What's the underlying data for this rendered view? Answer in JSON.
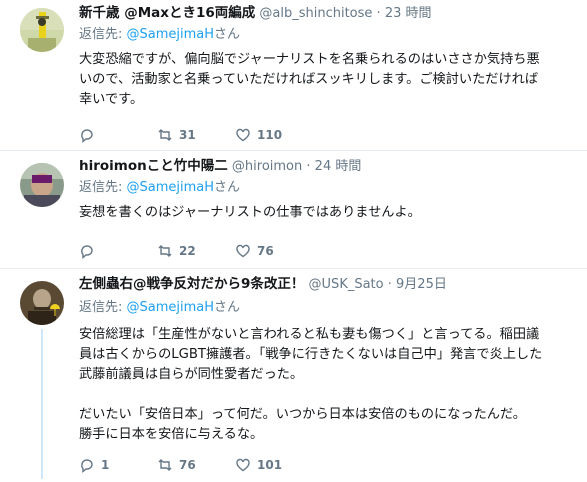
{
  "tweets": [
    {
      "name": "新千歳 @Maxとき16両編成",
      "handle": "@alb_shinchitose",
      "dot": "·",
      "time": "23 時間",
      "reply_prefix": "返信先: ",
      "reply_to": "@SamejimaH",
      "reply_suffix": "さん",
      "lines": [
        "大変恐縮ですが、偏向脳でジャーナリストを名乗られるのはいささか気持ち悪",
        "いので、活動家と名乗っていただければスッキリします。ご検討いただければ",
        "幸いです。"
      ],
      "reply_count": "",
      "retweet_count": "31",
      "like_count": "110"
    },
    {
      "name": "hiroimonこと竹中陽二",
      "handle": "@hiroimon",
      "dot": "·",
      "time": "24 時間",
      "reply_prefix": "返信先: ",
      "reply_to": "@SamejimaH",
      "reply_suffix": "さん",
      "lines": [
        "妄想を書くのはジャーナリストの仕事ではありませんよ。"
      ],
      "reply_count": "",
      "retweet_count": "22",
      "like_count": "76"
    },
    {
      "name": "左側蟲右@戦争反対だから9条改正！",
      "handle": "@USK_Sato",
      "dot": "·",
      "time": "9月25日",
      "reply_prefix": "返信先: ",
      "reply_to": "@SamejimaH",
      "reply_suffix": "さん",
      "lines": [
        "安倍総理は「生産性がないと言われると私も妻も傷つく」と言ってる。稲田議",
        "員は古くからのLGBT擁護者。「戦争に行きたくないは自己中」発言で炎上した",
        "武藤前議員は自らが同性愛者だった。",
        "",
        "だいたい「安倍日本」って何だ。いつから日本は安倍のものになったんだ。",
        "勝手に日本を安倍に与えるな。"
      ],
      "reply_count": "1",
      "retweet_count": "76",
      "like_count": "101"
    }
  ],
  "colors": {
    "text": "#14171a",
    "muted": "#657786",
    "link": "#1da1f2",
    "border": "#e6ecf0"
  },
  "icons": [
    "reply-icon",
    "retweet-icon",
    "like-icon",
    "avatar"
  ]
}
